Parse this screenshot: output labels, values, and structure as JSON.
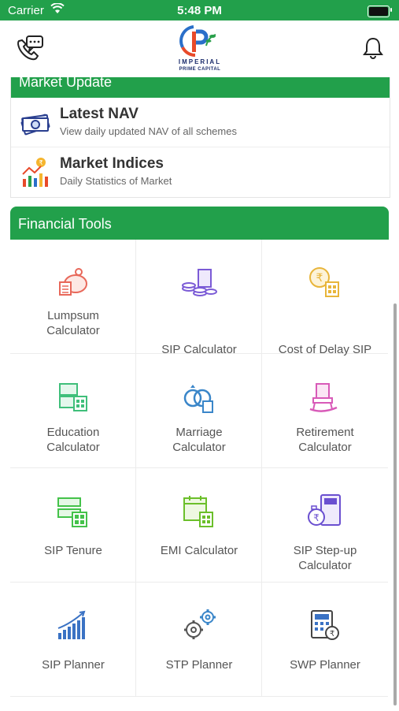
{
  "status_bar": {
    "carrier": "Carrier",
    "time": "5:48 PM"
  },
  "header": {
    "logo_line1": "IMPERIAL",
    "logo_line2": "PRIME CAPITAL"
  },
  "market_update": {
    "title": "Market Update",
    "items": [
      {
        "title": "Latest NAV",
        "subtitle": "View daily updated NAV of all schemes",
        "icon": "money-icon"
      },
      {
        "title": "Market Indices",
        "subtitle": "Daily Statistics of Market",
        "icon": "chart-icon"
      }
    ]
  },
  "financial_tools": {
    "title": "Financial Tools",
    "tools": [
      {
        "label": "Lumpsum Calculator",
        "icon": "piggy-bank-icon",
        "color": "#e8685a"
      },
      {
        "label": "SIP Calculator",
        "icon": "coins-icon",
        "color": "#7b5bd6"
      },
      {
        "label": "Cost of Delay SIP",
        "icon": "rupee-calculator-icon",
        "color": "#e8b53a"
      },
      {
        "label": "Education Calculator",
        "icon": "education-icon",
        "color": "#3fbf7a"
      },
      {
        "label": "Marriage Calculator",
        "icon": "rings-icon",
        "color": "#3a86c9"
      },
      {
        "label": "Retirement Calculator",
        "icon": "rocking-chair-icon",
        "color": "#d85ab8"
      },
      {
        "label": "SIP Tenure",
        "icon": "tenure-icon",
        "color": "#44c24a"
      },
      {
        "label": "EMI Calculator",
        "icon": "emi-calendar-icon",
        "color": "#6bbf2a"
      },
      {
        "label": "SIP Step-up Calculator",
        "icon": "step-up-icon",
        "color": "#6a4fd0"
      },
      {
        "label": "SIP Planner",
        "icon": "bar-growth-icon",
        "color": "#3a72c4"
      },
      {
        "label": "STP Planner",
        "icon": "gears-icon",
        "color": "#3a86c9"
      },
      {
        "label": "SWP Planner",
        "icon": "swp-calculator-icon",
        "color": "#3a72c4"
      }
    ]
  }
}
